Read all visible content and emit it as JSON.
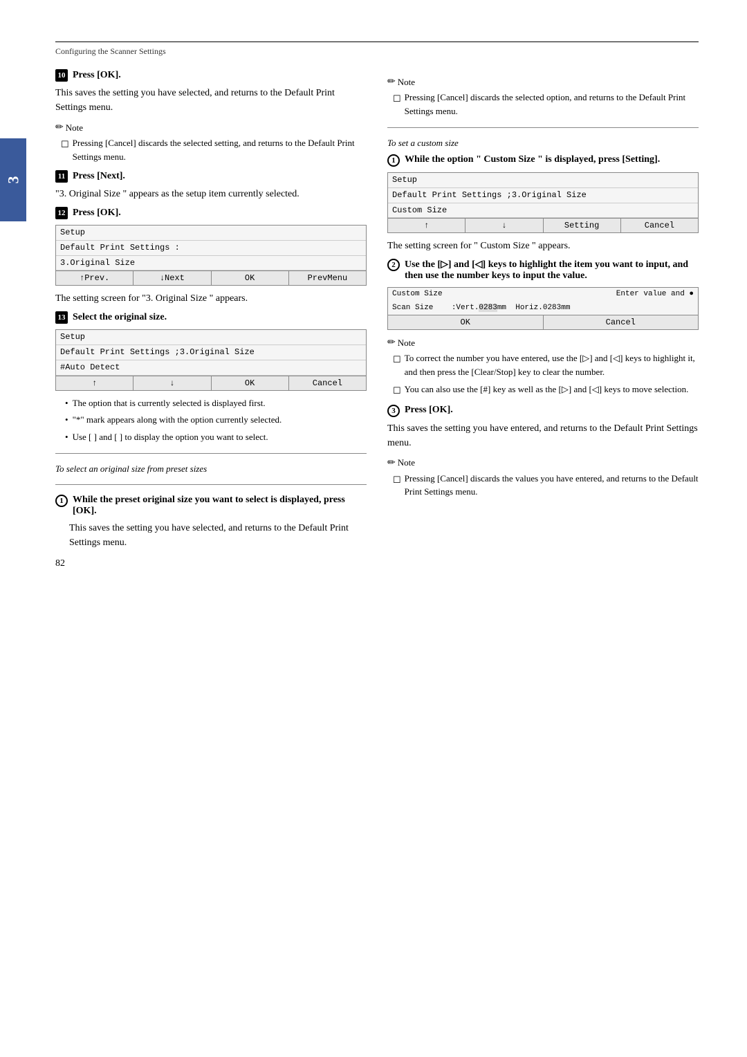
{
  "page": {
    "breadcrumb": "Configuring the Scanner Settings",
    "page_number": "82",
    "chapter_num": "3"
  },
  "left_col": {
    "step10": {
      "num": "10",
      "label": "Press [OK].",
      "body": "This saves the setting you have selected, and returns to the Default Print Settings menu.",
      "note_label": "Note",
      "note_items": [
        "Pressing [Cancel] discards the selected setting, and returns to the Default Print Settings menu."
      ]
    },
    "step11": {
      "num": "11",
      "label": "Press [Next].",
      "body": "\"3. Original Size \" appears as the setup item currently selected."
    },
    "step12": {
      "num": "12",
      "label": "Press [OK].",
      "lcd": {
        "rows": [
          "Setup",
          "Default Print Settings :",
          "3.Original Size"
        ],
        "buttons": [
          "↑Prev.",
          "↓Next",
          "OK",
          "PrevMenu"
        ]
      },
      "body": "The setting screen for \"3. Original Size \" appears."
    },
    "step13": {
      "num": "13",
      "label": "Select the original size.",
      "lcd": {
        "rows": [
          "Setup",
          "Default Print Settings ;3.Original Size",
          "#Auto Detect"
        ],
        "buttons": [
          "↑",
          "↓",
          "OK",
          "Cancel"
        ]
      },
      "bullets": [
        "The option that is currently selected is displayed first.",
        "\"*\" mark appears along with the option currently selected.",
        "Use [ ] and [ ] to display the option you want to select."
      ]
    },
    "divider1": "To select an original size from preset sizes",
    "preset_step1": {
      "circle": "1",
      "label": "While the preset original size you want to select is displayed, press [OK].",
      "body": "This saves the setting you have selected, and returns to the Default Print Settings menu."
    }
  },
  "right_col": {
    "note_top": {
      "note_label": "Note",
      "note_items": [
        "Pressing [Cancel] discards the selected option, and returns to the Default Print Settings menu."
      ]
    },
    "divider1": "To set a custom size",
    "custom_step1": {
      "circle": "1",
      "label": "While the option \" Custom Size \" is displayed, press [Setting].",
      "lcd": {
        "rows": [
          "Setup",
          "Default Print Settings ;3.Original Size",
          "Custom Size"
        ],
        "buttons": [
          "↑",
          "↓",
          "Setting",
          "Cancel"
        ]
      },
      "body": "The setting screen for \" Custom Size \" appears."
    },
    "custom_step2": {
      "circle": "2",
      "label": "Use the [▷] and [◁] keys to highlight the item you want to input, and then use the number keys to input the value.",
      "lcd": {
        "header_row": "Custom Size          Enter value and ●",
        "scan_row": "Scan Size    ;Vert.0283mm  Horiz.0283mm",
        "buttons": [
          "OK",
          "Cancel"
        ]
      },
      "note_label": "Note",
      "note_items": [
        "To correct the number you have entered, use the [▷] and [◁] keys to highlight it, and then press the [Clear/Stop] key to clear the number.",
        "You can also use the [#] key as well as the [▷] and [◁] keys to move selection."
      ]
    },
    "custom_step3": {
      "circle": "3",
      "label": "Press [OK].",
      "body": "This saves the setting you have entered, and returns to the Default Print Settings menu.",
      "note_label": "Note",
      "note_items": [
        "Pressing [Cancel] discards the values you have entered, and returns to the Default Print Settings menu."
      ]
    }
  }
}
